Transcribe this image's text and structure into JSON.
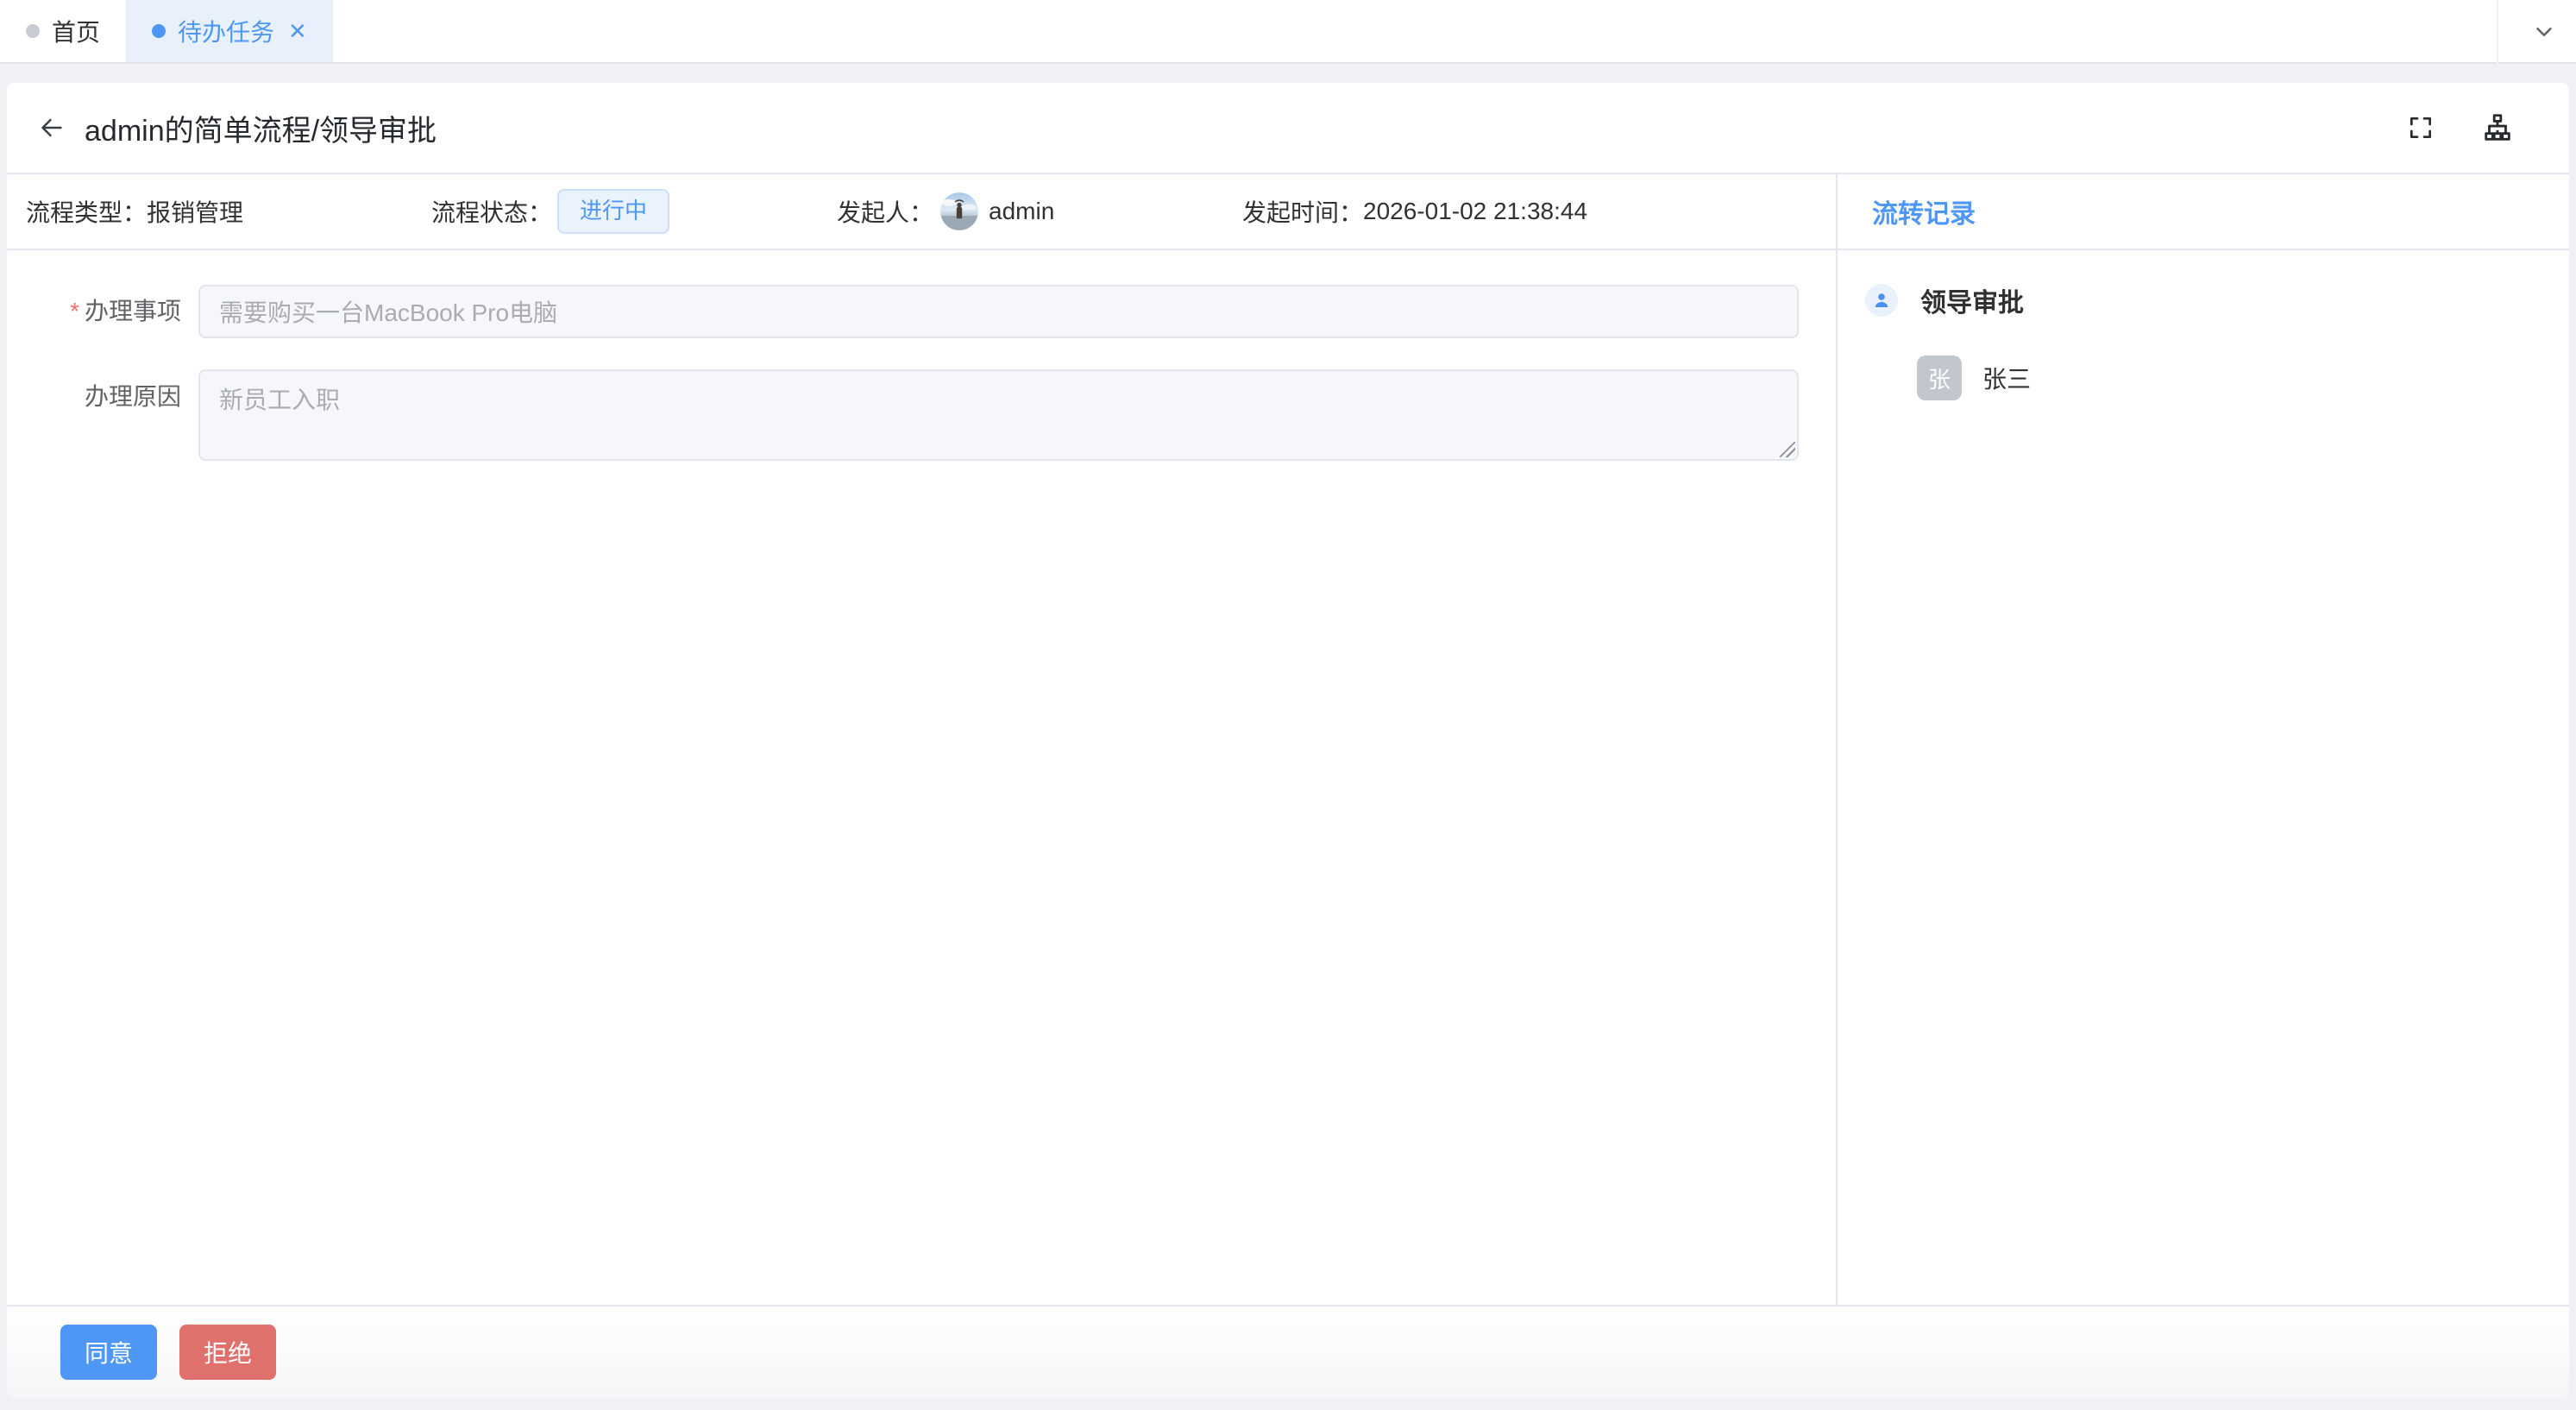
{
  "tabbar": {
    "tabs": [
      {
        "label": "首页",
        "active": false,
        "closable": false
      },
      {
        "label": "待办任务",
        "active": true,
        "closable": true
      }
    ]
  },
  "icons": {
    "tab_close": "✕",
    "back": "←",
    "fullscreen": "⛶",
    "flow_chart": "organization-chart",
    "chevron_down": "⌄",
    "user": "person-silhouette"
  },
  "header": {
    "title": "admin的简单流程/领导审批"
  },
  "meta": {
    "type_label": "流程类型：",
    "type_value": "报销管理",
    "status_label": "流程状态：",
    "status_value": "进行中",
    "initiator_label": "发起人：",
    "initiator_value": "admin",
    "time_label": "发起时间：",
    "time_value": "2026-01-02 21:38:44"
  },
  "form": {
    "fields": [
      {
        "label": "办理事项",
        "required_marker": "*",
        "value": "需要购买一台MacBook Pro电脑",
        "type": "input"
      },
      {
        "label": "办理原因",
        "value": "新员工入职",
        "type": "textarea"
      }
    ]
  },
  "panel": {
    "title": "流转记录",
    "records": [
      {
        "node": "领导审批",
        "assignees": [
          {
            "name": "张三",
            "avatar_text": "张"
          }
        ]
      }
    ]
  },
  "footer": {
    "approve_label": "同意",
    "reject_label": "拒绝"
  },
  "colors": {
    "primary": "#4e97f6",
    "danger": "#e0706b",
    "badge_bg": "#e9f2fd",
    "badge_border": "#cbdffb"
  }
}
